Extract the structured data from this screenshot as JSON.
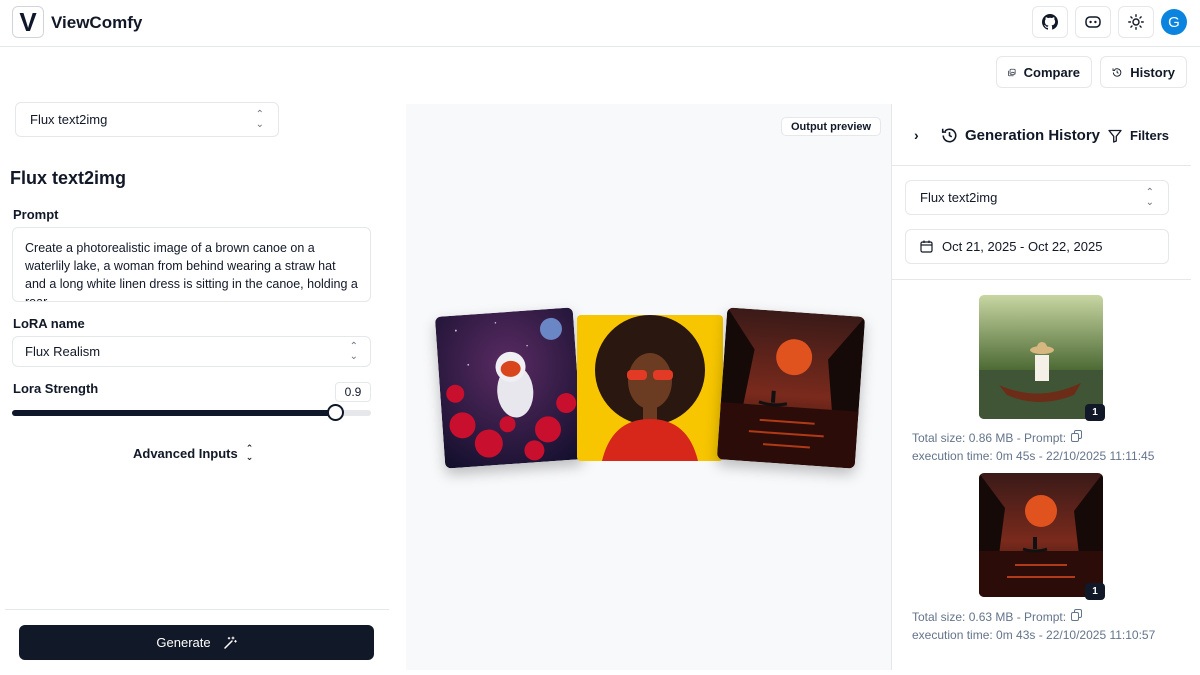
{
  "app": {
    "logo_letter": "V",
    "name": "ViewComfy",
    "avatar_letter": "G"
  },
  "topbar": {
    "icons": [
      "github-icon",
      "discord-icon",
      "sun-icon"
    ]
  },
  "actions": {
    "compare_label": "Compare",
    "history_label": "History"
  },
  "left": {
    "workflow_select": "Flux text2img",
    "form_title": "Flux text2img",
    "prompt_label": "Prompt",
    "prompt_value": "Create a photorealistic image of a brown canoe on a waterlily lake, a woman from behind wearing a straw hat and a long white linen dress is sitting in the canoe, holding a roar",
    "lora_label": "LoRA name",
    "lora_value": "Flux Realism",
    "strength_label": "Lora Strength",
    "strength_value": "0.9",
    "strength_fraction": 0.9,
    "advanced_label": "Advanced Inputs",
    "generate_label": "Generate"
  },
  "preview": {
    "badge": "Output preview"
  },
  "history": {
    "title": "Generation History",
    "filters_label": "Filters",
    "workflow_select": "Flux text2img",
    "date_range": "Oct 21, 2025 - Oct 22, 2025",
    "items": [
      {
        "count": "1",
        "size_line": "Total size: 0.86 MB - Prompt:",
        "time_line": "execution time: 0m 45s - 22/10/2025 11:11:45"
      },
      {
        "count": "1",
        "size_line": "Total size: 0.63 MB - Prompt:",
        "time_line": "execution time: 0m 43s - 22/10/2025 11:10:57"
      }
    ]
  },
  "colors": {
    "primary": "#111827",
    "avatar": "#0b84e0",
    "border": "#e5e7eb",
    "preview_bg": "#f8f9fb"
  }
}
